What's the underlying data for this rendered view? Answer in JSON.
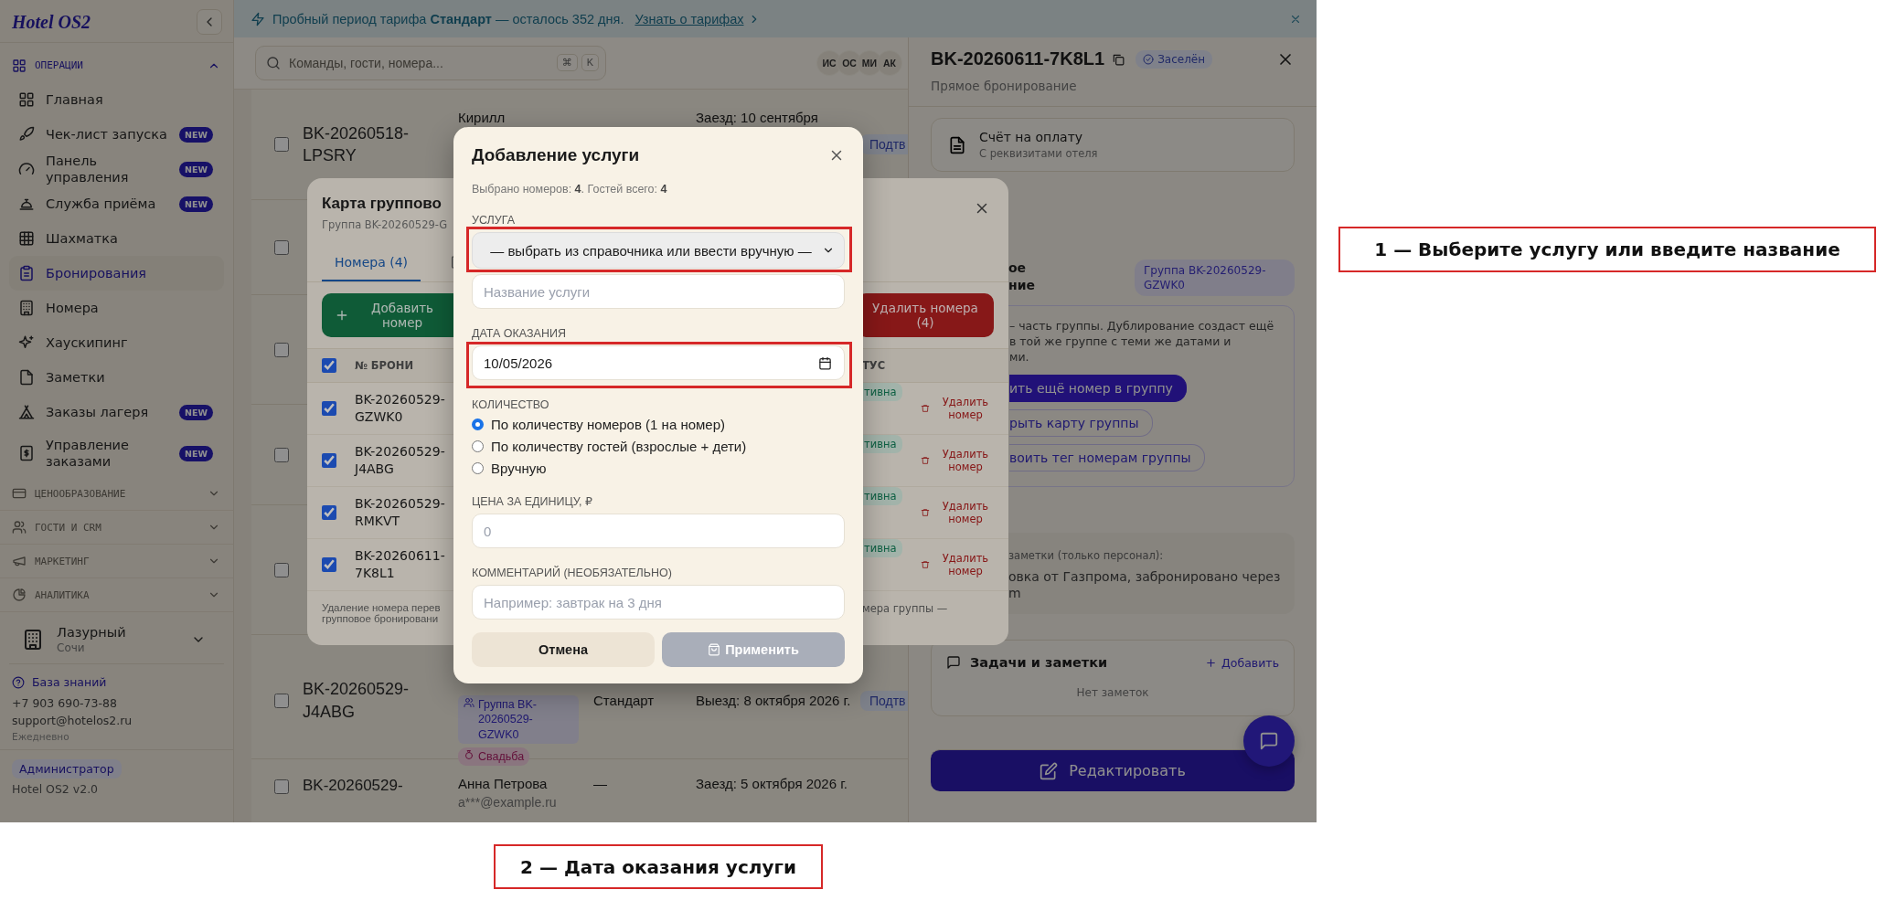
{
  "banner": {
    "text": "Пробный период тарифа **Стандарт** — осталось 352 дня.",
    "link": "Узнать о тарифах"
  },
  "sidebar": {
    "logo": "Hotel OS2",
    "sections": [
      {
        "title": "ОПЕРАЦИИ",
        "expanded": true,
        "items": [
          {
            "label": "Главная",
            "selected": false
          },
          {
            "label": "Чек-лист запуска",
            "badge": "NEW",
            "selected": false
          },
          {
            "label": "Панель управления",
            "badge": "NEW",
            "selected": false
          },
          {
            "label": "Служба приёма",
            "badge": "NEW",
            "selected": false
          },
          {
            "label": "Шахматка",
            "selected": false
          },
          {
            "label": "Бронирования",
            "selected": true
          },
          {
            "label": "Номера",
            "selected": false
          },
          {
            "label": "Хаускипинг",
            "selected": false
          },
          {
            "label": "Заметки",
            "selected": false
          },
          {
            "label": "Заказы лагеря",
            "badge": "NEW",
            "selected": false
          },
          {
            "label": "Управление заказами",
            "badge": "NEW",
            "selected": false
          }
        ]
      },
      {
        "title": "ЦЕНООБРАЗОВАНИЕ",
        "expanded": false
      },
      {
        "title": "ГОСТИ И CRM",
        "expanded": false
      },
      {
        "title": "МАРКЕТИНГ",
        "expanded": false
      },
      {
        "title": "АНАЛИТИКА",
        "expanded": false
      }
    ],
    "hotel": {
      "name": "Лазурный",
      "city": "Сочи"
    },
    "support": {
      "link": "База знаний",
      "phone": "+7 903 690-73-88",
      "email": "support@hotelos2.ru",
      "hours": "Ежедневно"
    },
    "role": "Администратор",
    "version": "Hotel OS2 v2.0"
  },
  "topbar": {
    "search": {
      "placeholder": "Команды, гости, номера...",
      "keys": [
        "⌘",
        "K"
      ]
    },
    "avatars": [
      "ИС",
      "ОС",
      "МИ",
      "АК"
    ]
  },
  "bookings": {
    "rows": [
      {
        "checked": false,
        "id": "BK-20260518-LPSRY",
        "guest": "Кирилл",
        "dates": "Заезд: 10 сентября",
        "status": "Подтв"
      },
      {
        "checked": false
      },
      {
        "checked": false
      },
      {
        "checked": false
      },
      {
        "checked": false
      },
      {
        "checked": false,
        "id": "BK-20260529-J4ABG",
        "tags": [
          {
            "kind": "group",
            "text": "Группа BK-20260529-GZWK0"
          },
          {
            "kind": "event",
            "text": "Свадьба"
          }
        ],
        "room": "Стандарт",
        "dates": "Выезд: 8 октября 2026 г.",
        "status": "Подтв"
      },
      {
        "checked": false,
        "id": "BK-20260529-",
        "guest": "Анна Петрова",
        "email": "a***@example.ru",
        "room": "—",
        "dates": "Заезд: 5 октября 2026 г."
      }
    ]
  },
  "group_card": {
    "title": "Карта группово",
    "subtitle": "Группа BK-20260529-G",
    "tabs": [
      {
        "kind": "text",
        "label": "Номера (4)",
        "selected": true
      },
      {
        "kind": "icon",
        "selected": false
      }
    ],
    "add_button": "Добавить номер",
    "delete_button": "Удалить номера (4)",
    "select_all": true,
    "columns": [
      "№ БРОНИ",
      "ТУС"
    ],
    "rows": [
      {
        "checked": true,
        "id": "BK-20260529-GZWK0",
        "status": "тивна",
        "action": "Удалить номер"
      },
      {
        "checked": true,
        "id": "BK-20260529-J4ABG",
        "status": "тивна",
        "action": "Удалить номер"
      },
      {
        "checked": true,
        "id": "BK-20260529-RMKVT",
        "status": "тивна",
        "action": "Удалить номер"
      },
      {
        "checked": true,
        "id": "BK-20260611-7K8L1",
        "status": "тивна",
        "action": "Удалить номер"
      }
    ],
    "footer_left": [
      "Удаление номера перев",
      "групповое бронировани"
    ],
    "footer_right": "мера группы —"
  },
  "drawer": {
    "title": "BK-20260611-7K8L1",
    "status": "Заселён",
    "source": "Прямое бронирование",
    "invoice": {
      "title": "Счёт на оплату",
      "subtitle": "С реквизитами отеля"
    },
    "group": {
      "heading": [
        "ое",
        "ние"
      ],
      "badge": "Группа BK-20260529-GZWK0",
      "info": [
        "– часть группы. Дублирование создаст ещё",
        "в той же группе с теми же датами и",
        "ми."
      ],
      "actions": [
        {
          "kind": "primary",
          "label": "ить ещё номер в группу"
        },
        {
          "kind": "outline",
          "label": "рыть карту группы"
        },
        {
          "kind": "outline",
          "label": "воить тег номерам группы"
        }
      ]
    },
    "notes": {
      "label": "заметки (только персонал):",
      "lines": [
        "овка от Газпрома, забронировано через",
        "m"
      ]
    },
    "tasks": {
      "title": "Задачи и заметки",
      "add": "Добавить",
      "empty": "Нет заметок"
    },
    "edit_button": "Редактировать"
  },
  "modal": {
    "title": "Добавление услуги",
    "summary": "Выбрано номеров: **4**. Гостей всего: **4**",
    "service": {
      "label": "УСЛУГА",
      "value": "— выбрать из справочника или ввести вручную —",
      "name_placeholder": "Название услуги"
    },
    "date": {
      "label": "ДАТА ОКАЗАНИЯ",
      "value": "10/05/2026"
    },
    "quantity": {
      "label": "КОЛИЧЕСТВО",
      "options": [
        {
          "label": "По количеству номеров (1 на номер)",
          "selected": true
        },
        {
          "label": "По количеству гостей (взрослые + дети)",
          "selected": false
        },
        {
          "label": "Вручную",
          "selected": false
        }
      ]
    },
    "price": {
      "label": "ЦЕНА ЗА ЕДИНИЦУ, ₽",
      "placeholder": "0"
    },
    "comment": {
      "label": "КОММЕНТАРИЙ (НЕОБЯЗАТЕЛЬНО)",
      "placeholder": "Например: завтрак на 3 дня"
    },
    "buttons": [
      {
        "kind": "cancel",
        "label": "Отмена",
        "disabled": false
      },
      {
        "kind": "apply",
        "label": "Применить",
        "disabled": true
      }
    ]
  },
  "annotations": [
    {
      "label": "1 — Выберите услугу или введите название"
    },
    {
      "label": "2 — Дата оказания услуги"
    }
  ]
}
